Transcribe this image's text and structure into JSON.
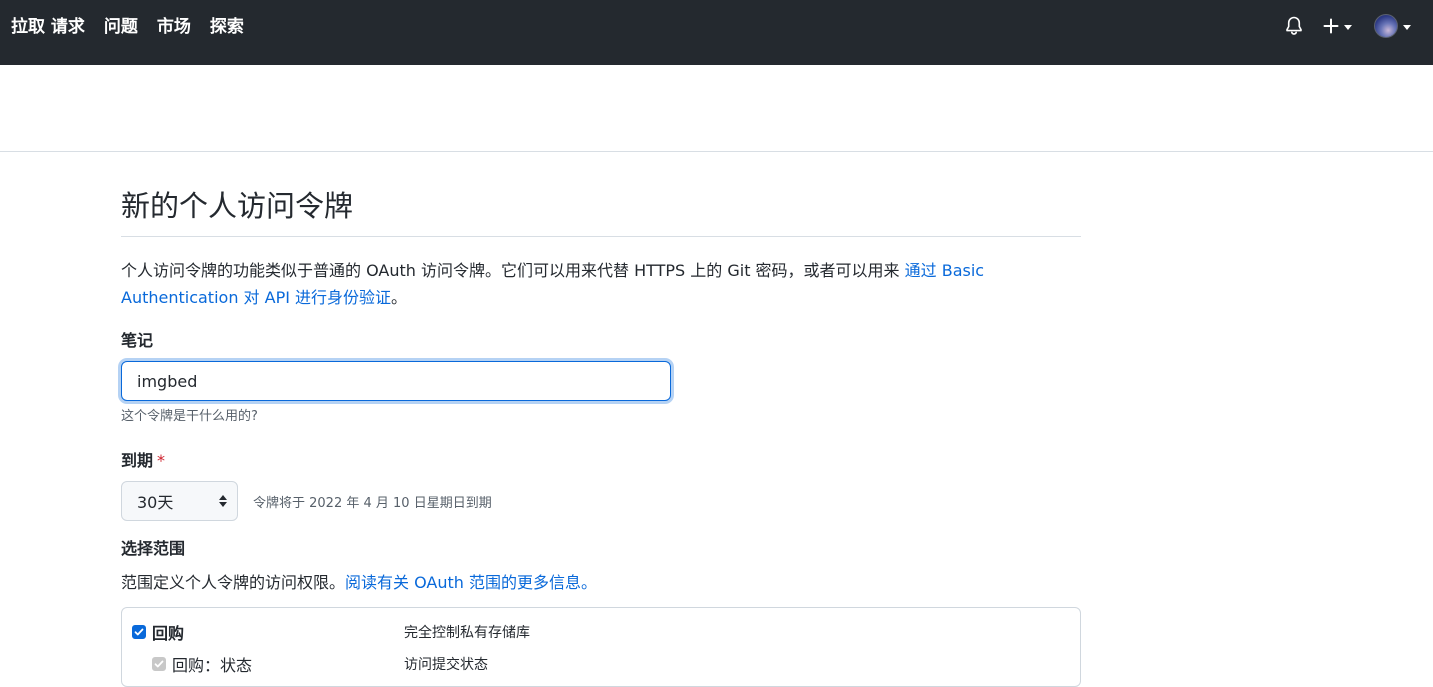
{
  "header": {
    "nav": [
      "拉取 请求",
      "问题",
      "市场",
      "探索"
    ],
    "bell_icon": "bell-icon",
    "plus_icon": "plus-icon",
    "avatar_icon": "user-avatar"
  },
  "main": {
    "title": "新的个人访问令牌",
    "description_text": "个人访问令牌的功能类似于普通的 OAuth 访问令牌。它们可以用来代替 HTTPS 上的 Git 密码，或者可以用来 ",
    "description_link": "通过 Basic Authentication 对 API 进行身份验证",
    "description_end": "。",
    "note": {
      "label": "笔记",
      "value": "imgbed",
      "hint": "这个令牌是干什么用的?"
    },
    "expiration": {
      "label": "到期",
      "required_mark": "*",
      "selected": "30天",
      "note": "令牌将于 2022 年 4 月 10 日星期日到期"
    },
    "scopes": {
      "label": "选择范围",
      "description_text": "范围定义个人令牌的访问权限。",
      "description_link": "阅读有关 OAuth 范围的更多信息。",
      "items": [
        {
          "name": "回购",
          "description": "完全控制私有存储库",
          "checked": true
        },
        {
          "name": "回购：状态",
          "description": "访问提交状态",
          "checked": true
        }
      ]
    }
  },
  "colors": {
    "header_bg": "#24292f",
    "link": "#0969da",
    "required": "#cf222e"
  }
}
